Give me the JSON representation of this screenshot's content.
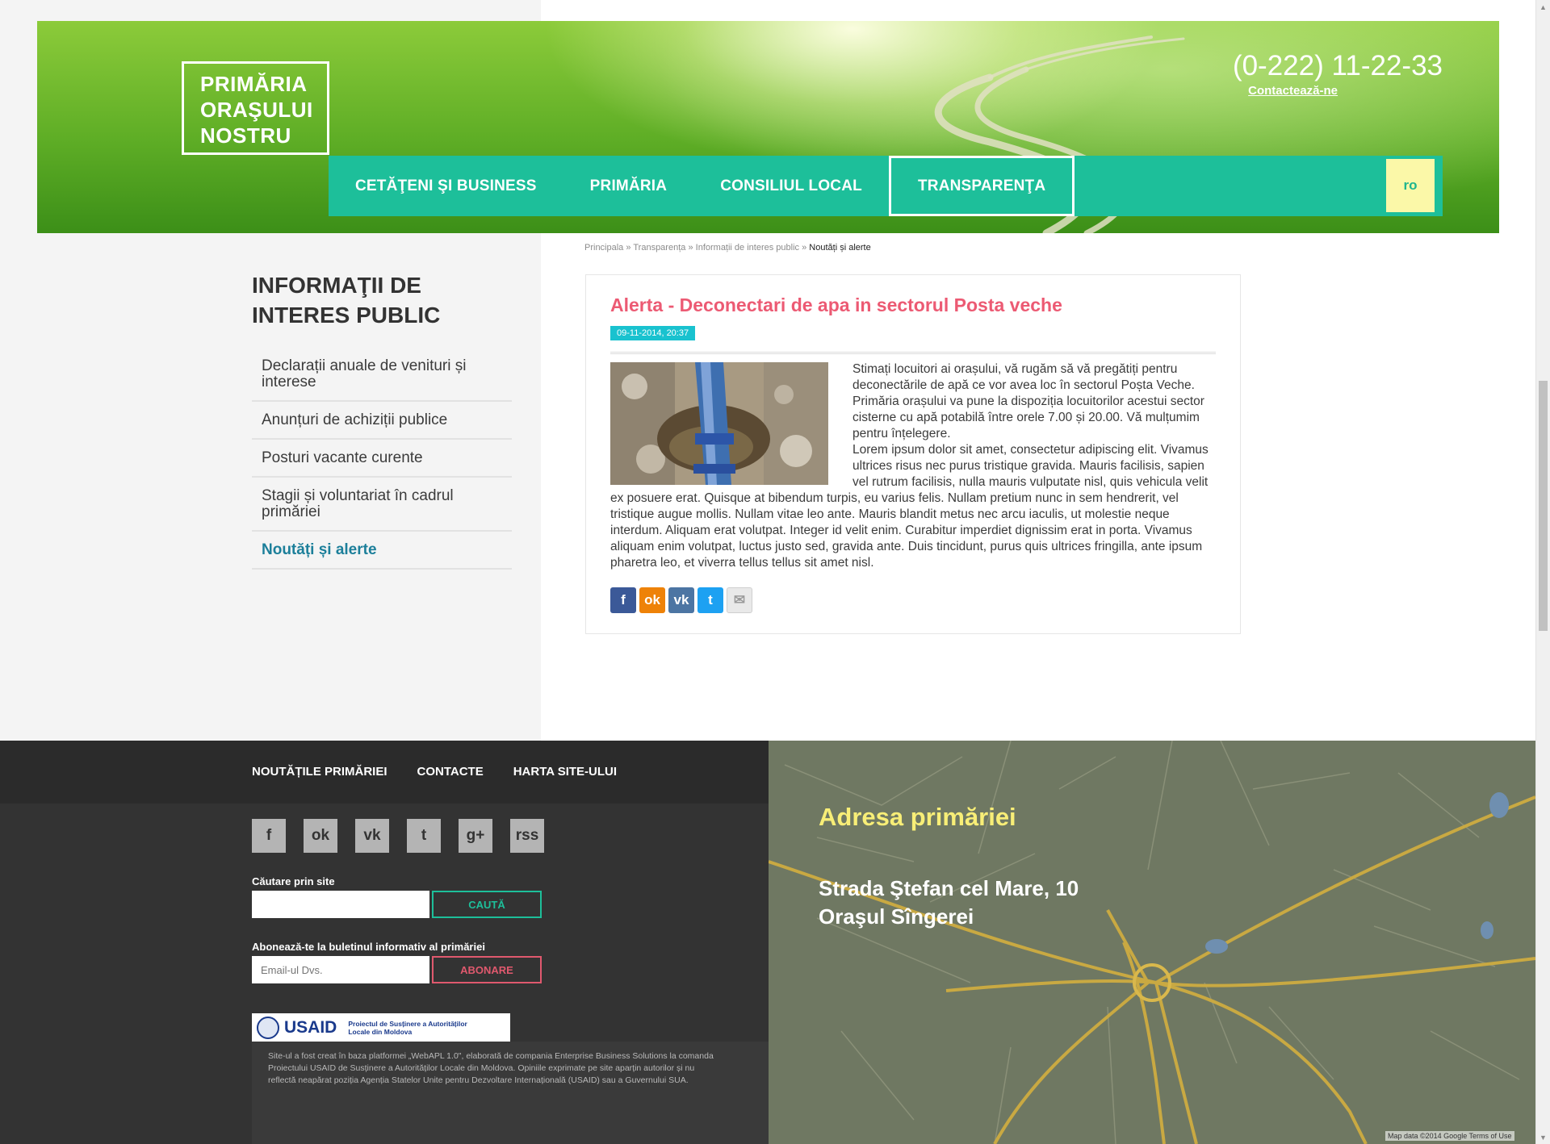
{
  "header": {
    "logo_lines": [
      "PRIMĂRIA",
      "ORAŞULUI",
      "NOSTRU"
    ],
    "phone": "(0-222) 11-22-33",
    "contact_link": "Contactează-ne",
    "nav": [
      "CETĂŢENI ŞI BUSINESS",
      "PRIMĂRIA",
      "CONSILIUL LOCAL",
      "TRANSPARENŢA"
    ],
    "active_nav": "TRANSPARENŢA",
    "lang": "ro"
  },
  "breadcrumb": {
    "items": [
      "Principala",
      "Transparența",
      "Informații de interes public"
    ],
    "separator": "»",
    "current": "Noutăți și alerte"
  },
  "sidebar": {
    "title_lines": [
      "INFORMAŢII DE",
      "INTERES PUBLIC"
    ],
    "items": [
      "Declarații anuale de venituri și interese",
      "Anunțuri de achiziții publice",
      "Posturi vacante curente",
      "Stagii și voluntariat în cadrul primăriei",
      "Noutăți și alerte"
    ],
    "active_item": "Noutăți și alerte"
  },
  "article": {
    "title": "Alerta - Deconectari de apa in sectorul Posta veche",
    "date": "09-11-2014, 20:37",
    "paragraph_1": "Stimați locuitori ai orașului, vă rugăm să vă pregătiți pentru deconectările de apă ce vor avea loc în sectorul Poșta Veche. Primăria orașului va pune la dispoziția locuitorilor acestui sector cisterne cu apă potabilă între orele 7.00 și 20.00. Vă mulțumim pentru înțelegere.",
    "paragraph_2": "Lorem ipsum dolor sit amet, consectetur adipiscing elit. Vivamus ultrices risus nec purus tristique gravida. Mauris facilisis, sapien vel rutrum facilisis, nulla mauris vulputate nisl, quis vehicula velit ex posuere erat. Quisque at bibendum turpis, eu varius felis. Nullam pretium nunc in sem hendrerit, vel tristique augue mollis. Nullam vitae leo ante. Mauris blandit metus nec arcu iaculis, ut molestie neque interdum. Aliquam erat volutpat. Integer id velit enim. Curabitur imperdiet dignissim erat in porta. Vivamus aliquam enim volutpat, luctus justo sed, gravida ante. Duis tincidunt, purus quis ultrices fringilla, ante ipsum pharetra leo, et viverra tellus tellus sit amet nisl.",
    "share_buttons": [
      {
        "icon": "facebook-icon",
        "glyph": "f",
        "color": "#3b5998"
      },
      {
        "icon": "odnoklassniki-icon",
        "glyph": "ok",
        "color": "#ee8208"
      },
      {
        "icon": "vk-icon",
        "glyph": "vk",
        "color": "#4c75a3"
      },
      {
        "icon": "twitter-icon",
        "glyph": "t",
        "color": "#1da1f2"
      },
      {
        "icon": "email-icon",
        "glyph": "✉",
        "color": "#e9e9e9"
      }
    ]
  },
  "footer": {
    "nav": [
      "NOUTĂȚILE PRIMĂRIEI",
      "CONTACTE",
      "HARTA SITE-ULUI"
    ],
    "social": [
      {
        "icon": "facebook-icon",
        "glyph": "f"
      },
      {
        "icon": "odnoklassniki-icon",
        "glyph": "ok"
      },
      {
        "icon": "vk-icon",
        "glyph": "vk"
      },
      {
        "icon": "twitter-icon",
        "glyph": "t"
      },
      {
        "icon": "google-plus-icon",
        "glyph": "g+"
      },
      {
        "icon": "rss-icon",
        "glyph": "rss"
      }
    ],
    "search_label": "Căutare prin site",
    "search_value": "",
    "search_button": "CAUTĂ",
    "subscribe_label": "Abonează-te la buletinul informativ al primăriei",
    "subscribe_placeholder": "Email-ul Dvs.",
    "subscribe_button": "ABONARE",
    "usaid_text": "USAID",
    "usaid_project": "Proiectul de Susținere a Autorităților Locale din Moldova",
    "credit": "Site-ul a fost creat în baza platformei „WebAPL 1.0\", elaborată de compania Enterprise Business Solutions la comanda Proiectului USAID de Susținere a Autorităților Locale din Moldova. Opiniile exprimate pe site aparțin autorilor și nu reflectă neapărat poziția Agenția Statelor Unite pentru Dezvoltare Internațională (USAID) sau a Guvernului SUA."
  },
  "map": {
    "title": "Adresa primăriei",
    "address_line_1": "Strada Ştefan cel Mare, 10",
    "address_line_2": "Oraşul Sîngerei",
    "attribution": "Map data ©2014 Google   Terms of Use"
  },
  "colors": {
    "accent_green": "#1dbf9a",
    "title_pink": "#ec5a73",
    "date_teal": "#19c2cf",
    "address_yellow": "#f8ee77",
    "search_border": "#1dbf9a",
    "subscribe_border": "#e0596e"
  }
}
